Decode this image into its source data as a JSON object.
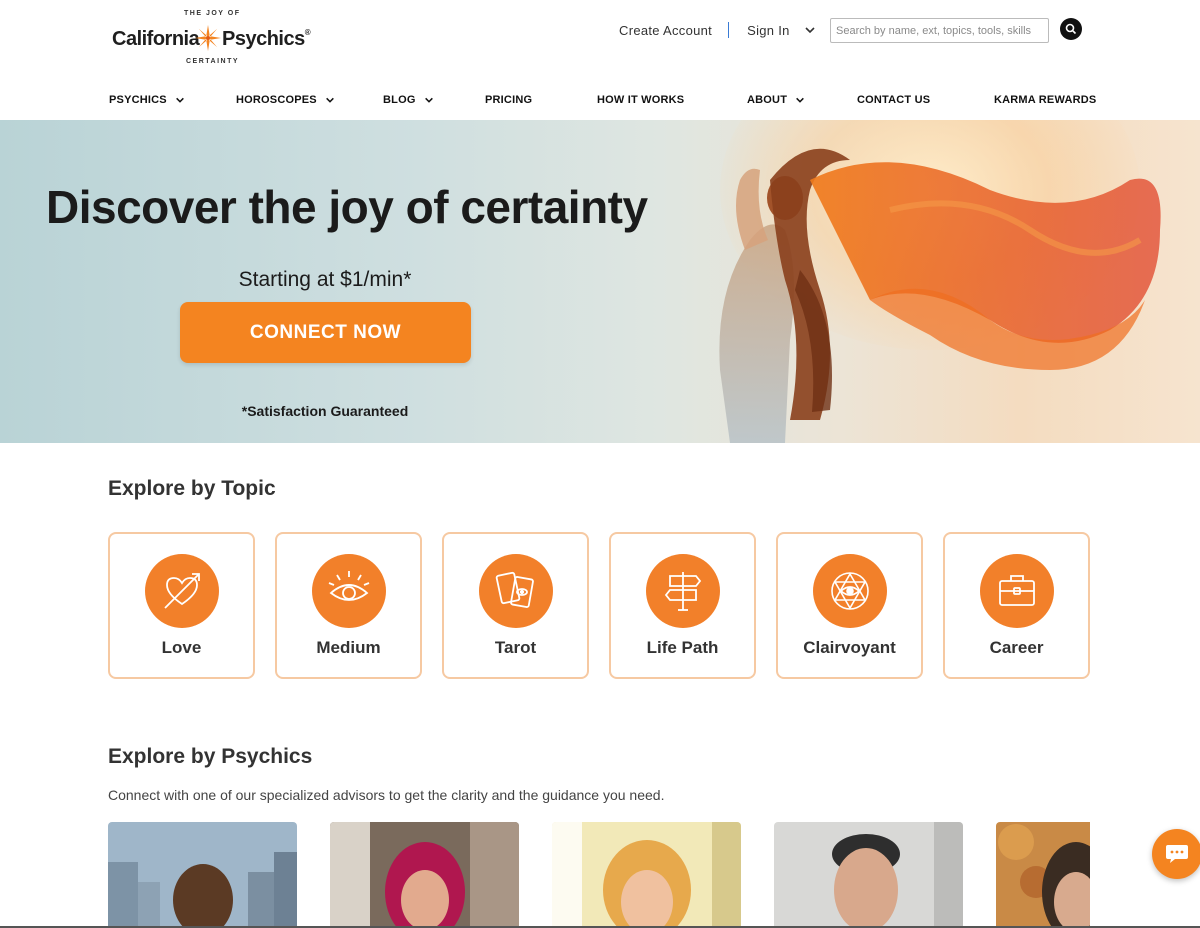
{
  "brand": {
    "name_left": "California",
    "name_right": "Psychics",
    "registered": "®",
    "tagline_top": "THE JOY OF",
    "tagline_bottom": "CERTAINTY",
    "accent_color": "#f48420"
  },
  "top_links": {
    "create_account": "Create Account",
    "sign_in": "Sign In"
  },
  "search": {
    "placeholder": "Search by name, ext, topics, tools, skills"
  },
  "nav": {
    "items": [
      {
        "label": "PSYCHICS",
        "has_dropdown": true
      },
      {
        "label": "HOROSCOPES",
        "has_dropdown": true
      },
      {
        "label": "BLOG",
        "has_dropdown": true
      },
      {
        "label": "PRICING",
        "has_dropdown": false
      },
      {
        "label": "HOW IT WORKS",
        "has_dropdown": false
      },
      {
        "label": "ABOUT",
        "has_dropdown": true
      },
      {
        "label": "CONTACT US",
        "has_dropdown": false
      },
      {
        "label": "KARMA REWARDS",
        "has_dropdown": false
      }
    ]
  },
  "hero": {
    "title": "Discover the joy of certainty",
    "subtitle": "Starting at $1/min*",
    "cta_label": "CONNECT NOW",
    "guarantee": "*Satisfaction Guaranteed"
  },
  "topics": {
    "title": "Explore by Topic",
    "items": [
      {
        "label": "Love",
        "icon": "heart-arrow-icon"
      },
      {
        "label": "Medium",
        "icon": "eye-icon"
      },
      {
        "label": "Tarot",
        "icon": "tarot-cards-icon"
      },
      {
        "label": "Life Path",
        "icon": "signpost-icon"
      },
      {
        "label": "Clairvoyant",
        "icon": "all-seeing-eye-icon"
      },
      {
        "label": "Career",
        "icon": "briefcase-icon"
      }
    ]
  },
  "psychics": {
    "title": "Explore by Psychics",
    "subtitle": "Connect with one of our specialized advisors to get the clarity and the guidance you need."
  }
}
